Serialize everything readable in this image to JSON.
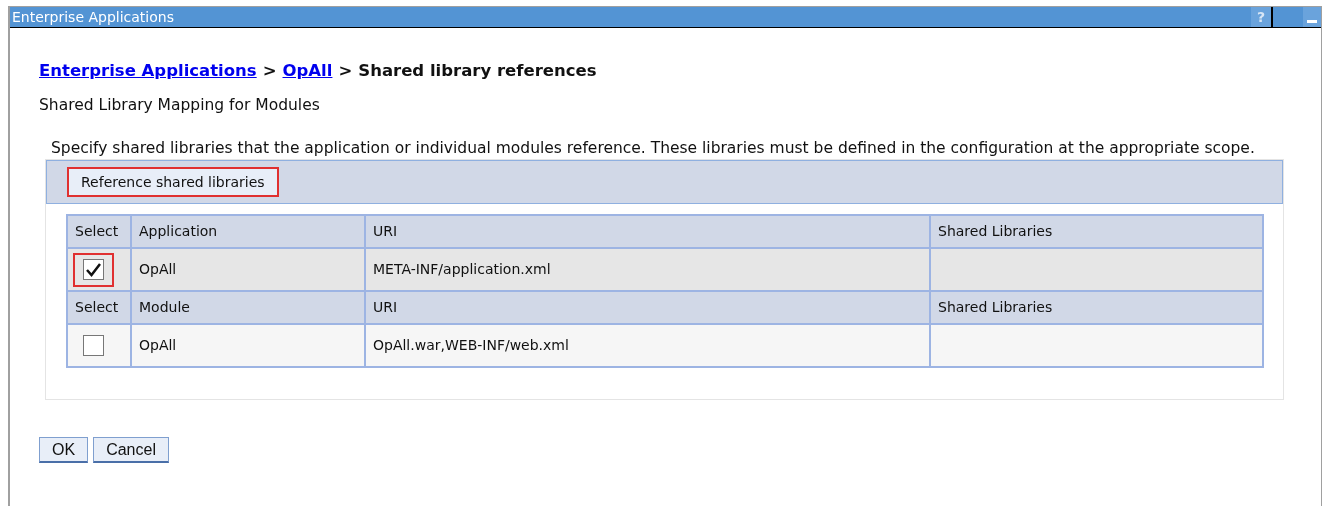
{
  "window": {
    "title": "Enterprise Applications",
    "help_glyph": "?"
  },
  "breadcrumb": [
    {
      "label": "Enterprise Applications",
      "kind": "link"
    },
    {
      "label": "OpAll",
      "kind": "link"
    },
    {
      "label": "Shared library references",
      "kind": "current"
    }
  ],
  "separator": ">",
  "subtitle": "Shared Library Mapping for Modules",
  "description": "Specify shared libraries that the application or individual modules reference. These libraries must be defined in the configuration at the appropriate scope.",
  "toolbar": {
    "button": "Reference shared libraries",
    "highlighted": true
  },
  "table": {
    "sections": [
      {
        "columns": [
          "Select",
          "Application",
          "URI",
          "Shared Libraries"
        ],
        "rows": [
          {
            "checked": true,
            "highlighted": true,
            "name": "OpAll",
            "uri": "META-INF/application.xml"
          }
        ]
      },
      {
        "columns": [
          "Select",
          "Module",
          "URI",
          "Shared Libraries"
        ],
        "rows": [
          {
            "checked": false,
            "highlighted": false,
            "name": "OpAll",
            "uri": "OpAll.war,WEB-INF/web.xml"
          }
        ]
      }
    ]
  },
  "buttons": [
    "OK",
    "Cancel"
  ]
}
